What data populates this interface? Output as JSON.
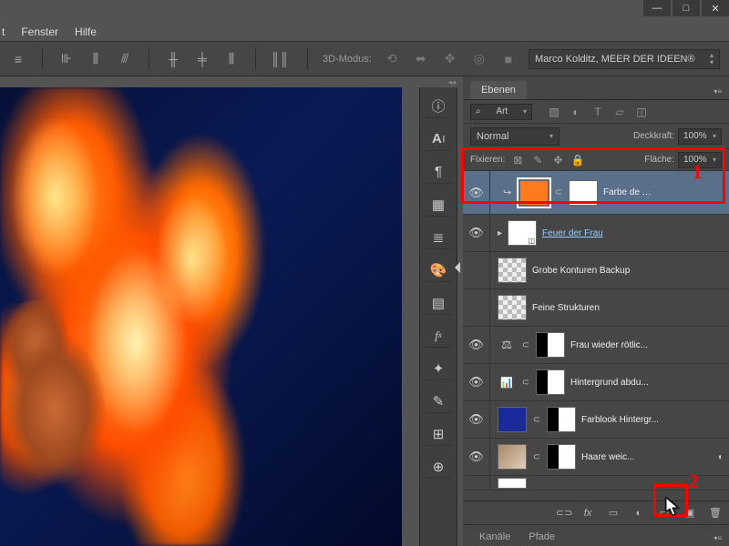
{
  "window": {
    "minimize": "—",
    "maximize": "□",
    "close": "✕"
  },
  "menubar": {
    "item1": "t",
    "fenster": "Fenster",
    "hilfe": "Hilfe"
  },
  "optbar": {
    "mode3d": "3D-Modus:",
    "workspace": "Marco Kolditz, MEER DER IDEEN®"
  },
  "panel": {
    "tab": "Ebenen",
    "search_label": "Art",
    "blend": "Normal",
    "opacity_label": "Deckkraft:",
    "opacity_val": "100%",
    "lock_label": "Fixieren:",
    "fill_label": "Fläche:",
    "fill_val": "100%"
  },
  "layers": [
    {
      "name": "Farbe de …",
      "color": "orange",
      "mask": "white",
      "visible": true,
      "selected": true,
      "clipped": true
    },
    {
      "name": "Feuer der Frau",
      "type": "smart",
      "visible": true,
      "underline": true
    },
    {
      "name": "Grobe Konturen Backup",
      "trans": true,
      "visible": false
    },
    {
      "name": "Feine Strukturen",
      "trans": true,
      "visible": false
    },
    {
      "name": "Frau wieder rötlic...",
      "adj": "balance",
      "mask": "mask1",
      "visible": true
    },
    {
      "name": "Hintergrund abdu...",
      "adj": "levels",
      "mask": "mask1",
      "visible": true
    },
    {
      "name": "Farblook Hintergr...",
      "color": "blue",
      "mask": "mask1",
      "visible": true
    },
    {
      "name": "Haare weic...",
      "photo": true,
      "mask": "mask1",
      "visible": true
    }
  ],
  "footer_icons": {
    "link": "⊂⊃",
    "fx": "fx",
    "mask": "▭",
    "adj": "◐",
    "group": "▭",
    "new": "▣",
    "del": "🗑"
  },
  "bottom_tabs": {
    "kanaele": "Kanäle",
    "pfade": "Pfade"
  },
  "anno": {
    "n1": "1",
    "n2": "2"
  }
}
